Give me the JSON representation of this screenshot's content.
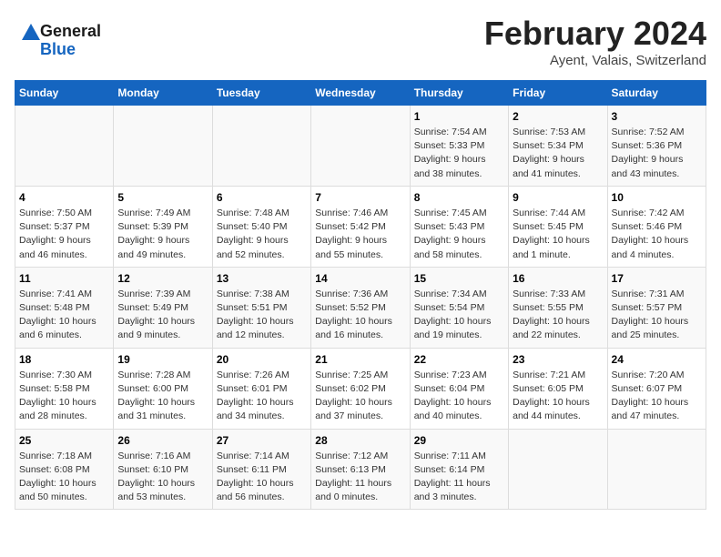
{
  "header": {
    "logo_line1": "General",
    "logo_line2": "Blue",
    "month_year": "February 2024",
    "location": "Ayent, Valais, Switzerland"
  },
  "days_of_week": [
    "Sunday",
    "Monday",
    "Tuesday",
    "Wednesday",
    "Thursday",
    "Friday",
    "Saturday"
  ],
  "weeks": [
    [
      {
        "day": "",
        "info": ""
      },
      {
        "day": "",
        "info": ""
      },
      {
        "day": "",
        "info": ""
      },
      {
        "day": "",
        "info": ""
      },
      {
        "day": "1",
        "info": "Sunrise: 7:54 AM\nSunset: 5:33 PM\nDaylight: 9 hours\nand 38 minutes."
      },
      {
        "day": "2",
        "info": "Sunrise: 7:53 AM\nSunset: 5:34 PM\nDaylight: 9 hours\nand 41 minutes."
      },
      {
        "day": "3",
        "info": "Sunrise: 7:52 AM\nSunset: 5:36 PM\nDaylight: 9 hours\nand 43 minutes."
      }
    ],
    [
      {
        "day": "4",
        "info": "Sunrise: 7:50 AM\nSunset: 5:37 PM\nDaylight: 9 hours\nand 46 minutes."
      },
      {
        "day": "5",
        "info": "Sunrise: 7:49 AM\nSunset: 5:39 PM\nDaylight: 9 hours\nand 49 minutes."
      },
      {
        "day": "6",
        "info": "Sunrise: 7:48 AM\nSunset: 5:40 PM\nDaylight: 9 hours\nand 52 minutes."
      },
      {
        "day": "7",
        "info": "Sunrise: 7:46 AM\nSunset: 5:42 PM\nDaylight: 9 hours\nand 55 minutes."
      },
      {
        "day": "8",
        "info": "Sunrise: 7:45 AM\nSunset: 5:43 PM\nDaylight: 9 hours\nand 58 minutes."
      },
      {
        "day": "9",
        "info": "Sunrise: 7:44 AM\nSunset: 5:45 PM\nDaylight: 10 hours\nand 1 minute."
      },
      {
        "day": "10",
        "info": "Sunrise: 7:42 AM\nSunset: 5:46 PM\nDaylight: 10 hours\nand 4 minutes."
      }
    ],
    [
      {
        "day": "11",
        "info": "Sunrise: 7:41 AM\nSunset: 5:48 PM\nDaylight: 10 hours\nand 6 minutes."
      },
      {
        "day": "12",
        "info": "Sunrise: 7:39 AM\nSunset: 5:49 PM\nDaylight: 10 hours\nand 9 minutes."
      },
      {
        "day": "13",
        "info": "Sunrise: 7:38 AM\nSunset: 5:51 PM\nDaylight: 10 hours\nand 12 minutes."
      },
      {
        "day": "14",
        "info": "Sunrise: 7:36 AM\nSunset: 5:52 PM\nDaylight: 10 hours\nand 16 minutes."
      },
      {
        "day": "15",
        "info": "Sunrise: 7:34 AM\nSunset: 5:54 PM\nDaylight: 10 hours\nand 19 minutes."
      },
      {
        "day": "16",
        "info": "Sunrise: 7:33 AM\nSunset: 5:55 PM\nDaylight: 10 hours\nand 22 minutes."
      },
      {
        "day": "17",
        "info": "Sunrise: 7:31 AM\nSunset: 5:57 PM\nDaylight: 10 hours\nand 25 minutes."
      }
    ],
    [
      {
        "day": "18",
        "info": "Sunrise: 7:30 AM\nSunset: 5:58 PM\nDaylight: 10 hours\nand 28 minutes."
      },
      {
        "day": "19",
        "info": "Sunrise: 7:28 AM\nSunset: 6:00 PM\nDaylight: 10 hours\nand 31 minutes."
      },
      {
        "day": "20",
        "info": "Sunrise: 7:26 AM\nSunset: 6:01 PM\nDaylight: 10 hours\nand 34 minutes."
      },
      {
        "day": "21",
        "info": "Sunrise: 7:25 AM\nSunset: 6:02 PM\nDaylight: 10 hours\nand 37 minutes."
      },
      {
        "day": "22",
        "info": "Sunrise: 7:23 AM\nSunset: 6:04 PM\nDaylight: 10 hours\nand 40 minutes."
      },
      {
        "day": "23",
        "info": "Sunrise: 7:21 AM\nSunset: 6:05 PM\nDaylight: 10 hours\nand 44 minutes."
      },
      {
        "day": "24",
        "info": "Sunrise: 7:20 AM\nSunset: 6:07 PM\nDaylight: 10 hours\nand 47 minutes."
      }
    ],
    [
      {
        "day": "25",
        "info": "Sunrise: 7:18 AM\nSunset: 6:08 PM\nDaylight: 10 hours\nand 50 minutes."
      },
      {
        "day": "26",
        "info": "Sunrise: 7:16 AM\nSunset: 6:10 PM\nDaylight: 10 hours\nand 53 minutes."
      },
      {
        "day": "27",
        "info": "Sunrise: 7:14 AM\nSunset: 6:11 PM\nDaylight: 10 hours\nand 56 minutes."
      },
      {
        "day": "28",
        "info": "Sunrise: 7:12 AM\nSunset: 6:13 PM\nDaylight: 11 hours\nand 0 minutes."
      },
      {
        "day": "29",
        "info": "Sunrise: 7:11 AM\nSunset: 6:14 PM\nDaylight: 11 hours\nand 3 minutes."
      },
      {
        "day": "",
        "info": ""
      },
      {
        "day": "",
        "info": ""
      }
    ]
  ]
}
